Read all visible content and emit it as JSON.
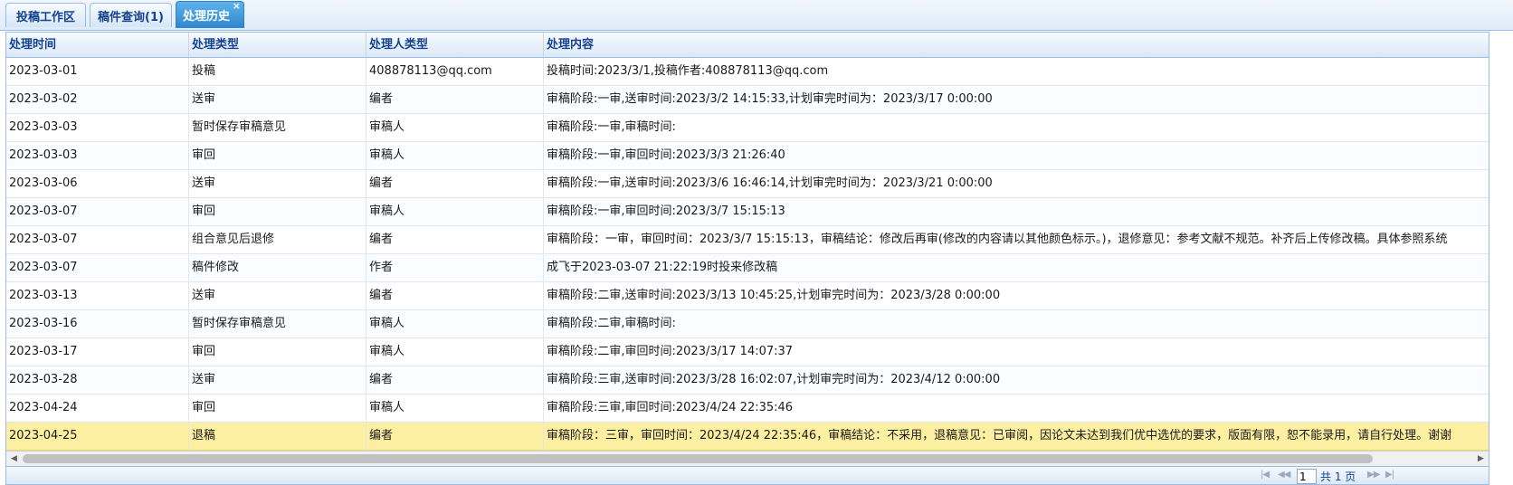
{
  "tabs": [
    {
      "label": "投稿工作区",
      "active": false
    },
    {
      "label": "稿件查询(1)",
      "active": false
    },
    {
      "label": "处理历史",
      "active": true
    }
  ],
  "tab_close_glyph": "×",
  "grid": {
    "columns": [
      "处理时间",
      "处理类型",
      "处理人类型",
      "处理内容"
    ],
    "rows": [
      [
        "2023-03-01",
        "投稿",
        "408878113@qq.com",
        "投稿时间:2023/3/1,投稿作者:408878113@qq.com"
      ],
      [
        "2023-03-02",
        "送审",
        "编者",
        "审稿阶段:一审,送审时间:2023/3/2 14:15:33,计划审完时间为：2023/3/17 0:00:00"
      ],
      [
        "2023-03-03",
        "暂时保存审稿意见",
        "审稿人",
        "审稿阶段:一审,审稿时间:"
      ],
      [
        "2023-03-03",
        "审回",
        "审稿人",
        "审稿阶段:一审,审回时间:2023/3/3 21:26:40"
      ],
      [
        "2023-03-06",
        "送审",
        "编者",
        "审稿阶段:一审,送审时间:2023/3/6 16:46:14,计划审完时间为：2023/3/21 0:00:00"
      ],
      [
        "2023-03-07",
        "审回",
        "审稿人",
        "审稿阶段:一审,审回时间:2023/3/7 15:15:13"
      ],
      [
        "2023-03-07",
        "组合意见后退修",
        "编者",
        "审稿阶段：一审，审回时间：2023/3/7 15:15:13，审稿结论：修改后再审(修改的内容请以其他颜色标示。)，退修意见：参考文献不规范。补齐后上传修改稿。具体参照系统"
      ],
      [
        "2023-03-07",
        "稿件修改",
        "作者",
        "成飞于2023-03-07 21:22:19时投来修改稿"
      ],
      [
        "2023-03-13",
        "送审",
        "编者",
        "审稿阶段:二审,送审时间:2023/3/13 10:45:25,计划审完时间为：2023/3/28 0:00:00"
      ],
      [
        "2023-03-16",
        "暂时保存审稿意见",
        "审稿人",
        "审稿阶段:二审,审稿时间:"
      ],
      [
        "2023-03-17",
        "审回",
        "审稿人",
        "审稿阶段:二审,审回时间:2023/3/17 14:07:37"
      ],
      [
        "2023-03-28",
        "送审",
        "编者",
        "审稿阶段:三审,送审时间:2023/3/28 16:02:07,计划审完时间为：2023/4/12 0:00:00"
      ],
      [
        "2023-04-24",
        "审回",
        "审稿人",
        "审稿阶段:三审,审回时间:2023/4/24 22:35:46"
      ],
      [
        "2023-04-25",
        "退稿",
        "编者",
        "审稿阶段：三审，审回时间：2023/4/24 22:35:46，审稿结论：不采用，退稿意见：已审阅，因论文未达到我们优中选优的要求，版面有限，恕不能录用，请自行处理。谢谢"
      ]
    ],
    "selected_row_index": 13
  },
  "scrollbar": {
    "left_arrow": "◀",
    "right_arrow": "▶"
  },
  "pager": {
    "first_glyph": "|◀",
    "prev_glyph": "◀◀",
    "next_glyph": "▶▶",
    "last_glyph": "▶|",
    "current_page": "1",
    "total_text": "共 1 页"
  },
  "colors": {
    "header_text": "#15428b",
    "selected_row": "#fcefa1",
    "active_tab": "#2d86cf",
    "border": "#99bbe8"
  }
}
